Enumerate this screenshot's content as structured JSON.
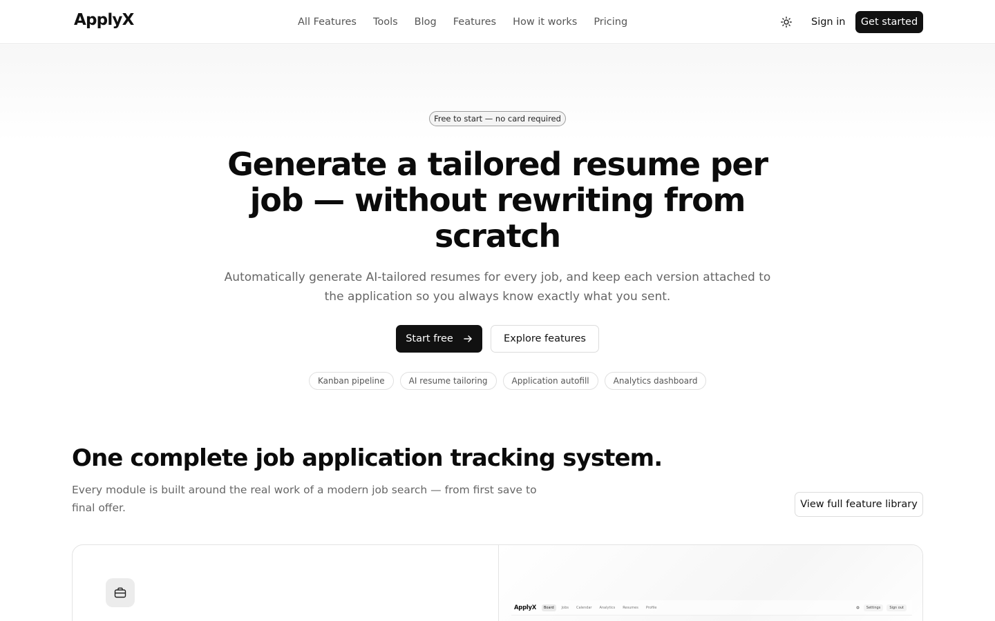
{
  "header": {
    "logo": "ApplyX",
    "nav": [
      "All Features",
      "Tools",
      "Blog",
      "Features",
      "How it works",
      "Pricing"
    ],
    "theme_icon": "sun-icon",
    "signin_label": "Sign in",
    "cta_label": "Get started"
  },
  "hero": {
    "badge": "Free to start — no card required",
    "title": "Generate a tailored resume per job — without rewriting from scratch",
    "subtitle": "Automatically generate AI-tailored resumes for every job, and keep each version attached to the application so you always know exactly what you sent.",
    "primary_label": "Start free",
    "primary_icon": "arrow-right-icon",
    "secondary_label": "Explore features",
    "chips": [
      "Kanban pipeline",
      "AI resume tailoring",
      "Application autofill",
      "Analytics dashboard"
    ]
  },
  "features": {
    "title": "One complete job application tracking system.",
    "subtitle": "Every module is built around the real work of a modern job search — from first save to final offer.",
    "library_label": "View full feature library",
    "card_icon": "briefcase-icon",
    "preview": {
      "logo": "ApplyX",
      "nav": [
        "Board",
        "Jobs",
        "Calendar",
        "Analytics",
        "Resumes",
        "Profile"
      ],
      "active": "Board",
      "settings_label": "Settings",
      "signout_label": "Sign out"
    }
  },
  "colors": {
    "primary": "#111111",
    "muted_text": "#666666",
    "border": "#e3e3e3"
  }
}
